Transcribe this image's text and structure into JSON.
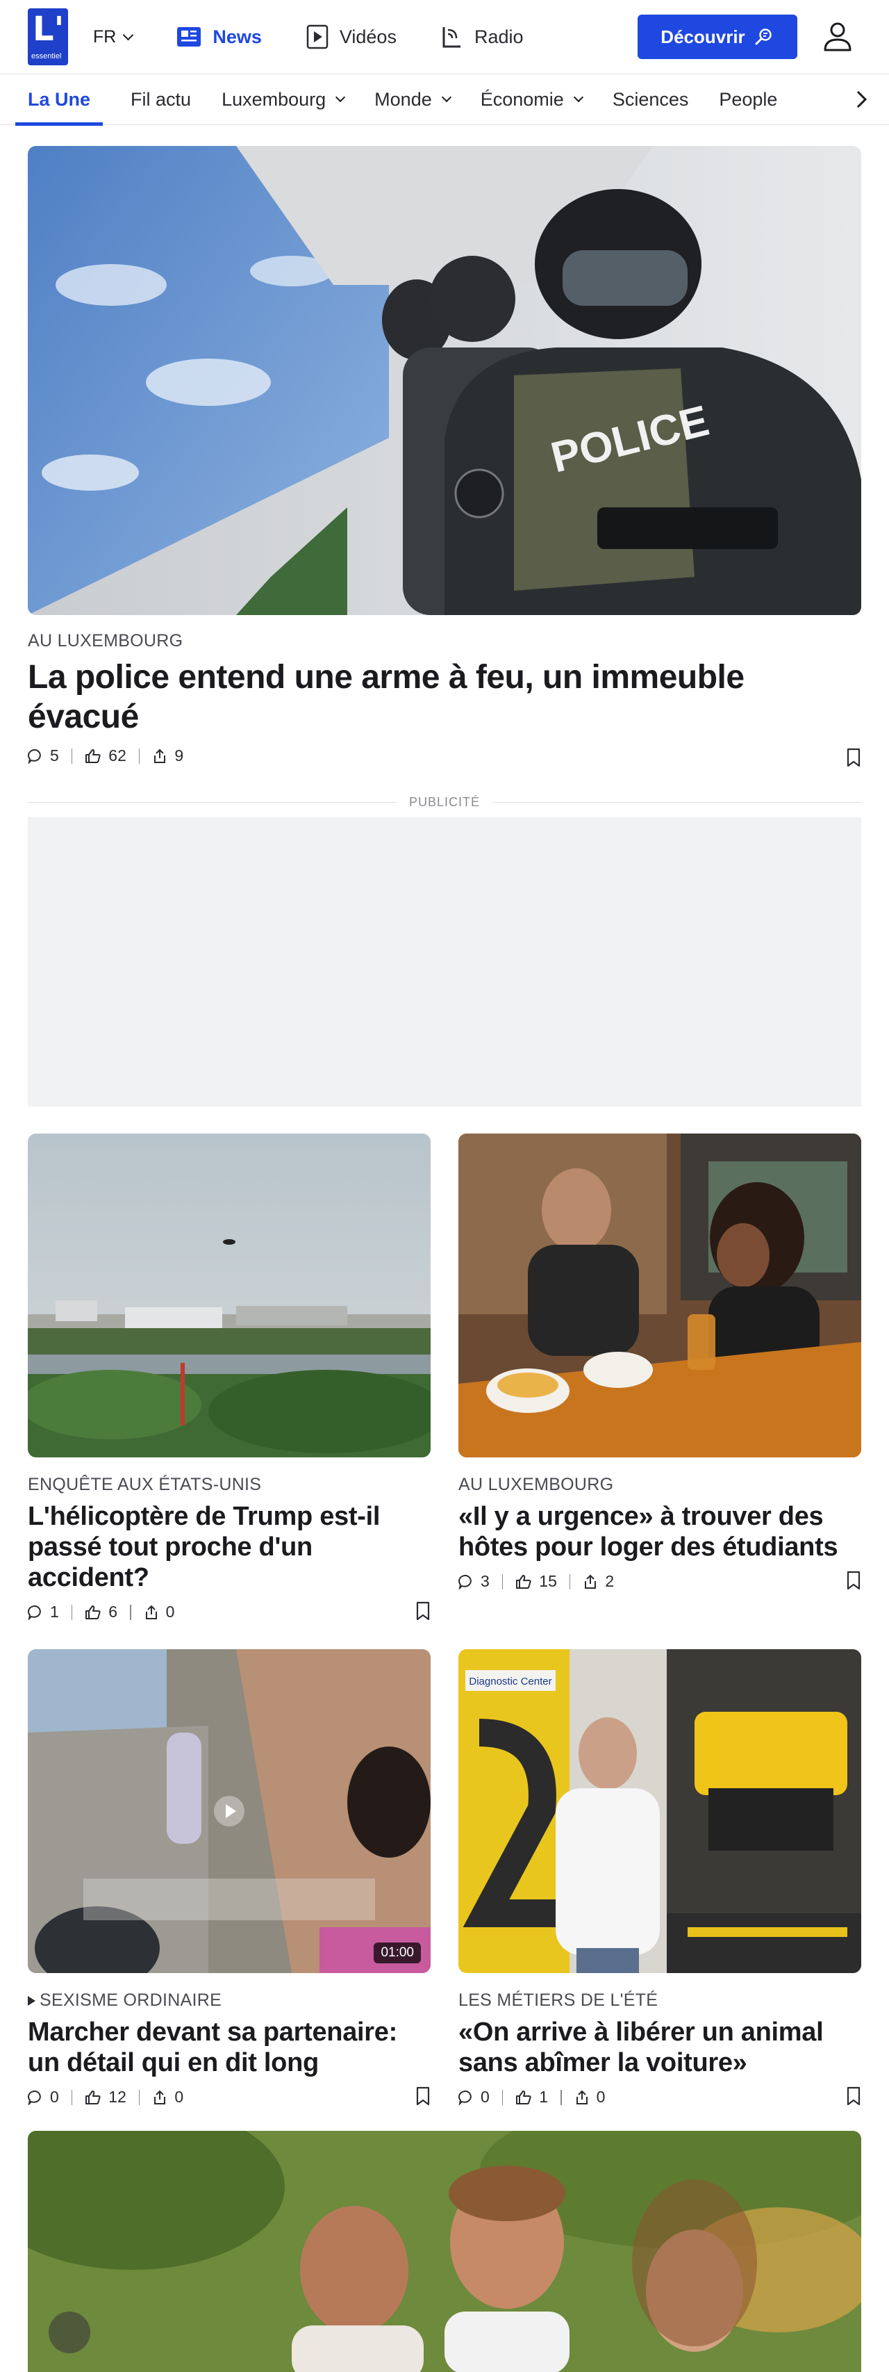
{
  "header": {
    "logo_letter": "L'",
    "logo_word": "essentiel",
    "language": "FR",
    "nav": [
      {
        "label": "News",
        "icon": "news-icon",
        "active": true
      },
      {
        "label": "Vidéos",
        "icon": "video-play-icon",
        "active": false
      },
      {
        "label": "Radio",
        "icon": "radio-icon",
        "active": false
      }
    ],
    "discover_label": "Découvrir",
    "accent": "#1f48e0"
  },
  "sections": {
    "tabs": [
      {
        "label": "La Une",
        "active": true
      },
      {
        "label": "Fil actu"
      },
      {
        "label": "Luxembourg",
        "dropdown": true
      },
      {
        "label": "Monde",
        "dropdown": true
      },
      {
        "label": "Économie",
        "dropdown": true
      },
      {
        "label": "Sciences"
      },
      {
        "label": "People"
      }
    ]
  },
  "hero": {
    "kicker": "AU LUXEMBOURG",
    "title": "La police entend une arme à feu, un immeuble évacué",
    "comments": "5",
    "likes": "62",
    "shares": "9"
  },
  "ad": {
    "label": "PUBLICITÉ"
  },
  "articles": [
    {
      "kicker": "ENQUÊTE AUX ÉTATS-UNIS",
      "title": "L'hélicoptère de Trump est-il passé tout proche d'un accident?",
      "comments": "1",
      "likes": "6",
      "shares": "0"
    },
    {
      "kicker": "AU LUXEMBOURG",
      "title": "«Il y a urgence» à trouver des hôtes pour loger des étudiants",
      "comments": "3",
      "likes": "15",
      "shares": "2"
    },
    {
      "kicker": "SEXISME ORDINAIRE",
      "title": "Marcher devant sa partenaire: un détail qui en dit long",
      "comments": "0",
      "likes": "12",
      "shares": "0",
      "duration": "01:00"
    },
    {
      "kicker": "LES MÉTIERS DE L'ÉTÉ",
      "title": "«On arrive à libérer un animal sans abîmer la voiture»",
      "comments": "0",
      "likes": "1",
      "shares": "0"
    }
  ]
}
